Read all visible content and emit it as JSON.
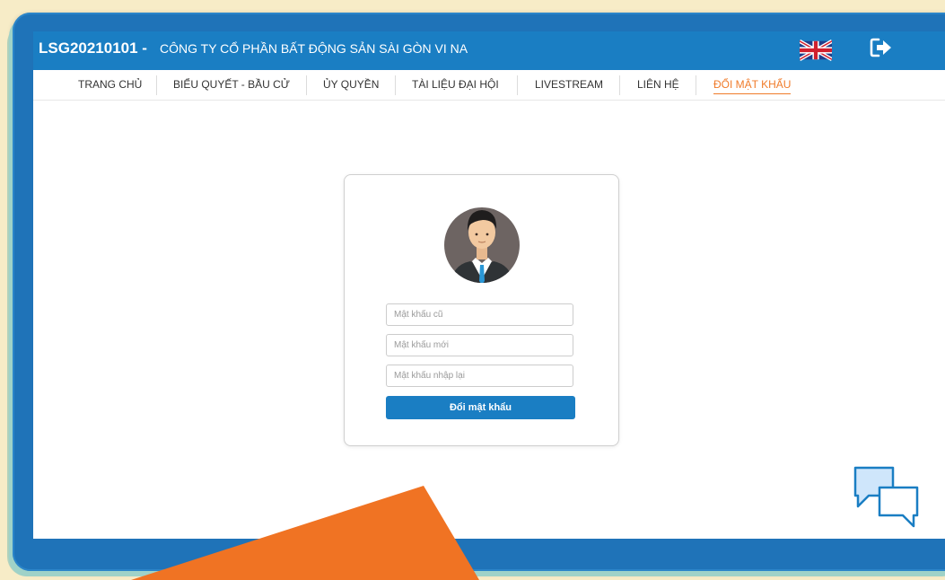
{
  "header": {
    "company_code": "LSG20210101 -",
    "company_name": "CÔNG TY CỔ PHẦN BẤT ĐỘNG SẢN SÀI GÒN VI NA"
  },
  "nav": {
    "items": [
      {
        "label": "TRANG CHỦ"
      },
      {
        "label": "BIỂU QUYẾT - BẦU CỬ"
      },
      {
        "label": "ỦY QUYỀN"
      },
      {
        "label": "TÀI LIỆU ĐẠI HỘI"
      },
      {
        "label": "LIVESTREAM"
      },
      {
        "label": "LIÊN HỆ"
      },
      {
        "label": "ĐỔI MẬT KHẨU",
        "active": true
      }
    ]
  },
  "form": {
    "old_password": {
      "placeholder": "Mật khẩu cũ",
      "value": ""
    },
    "new_password": {
      "placeholder": "Mật khẩu mới",
      "value": ""
    },
    "confirm_password": {
      "placeholder": "Mật khẩu nhập lại",
      "value": ""
    },
    "submit_label": "Đổi mật khẩu"
  },
  "icons": {
    "language": "uk-flag-icon",
    "logout": "logout-icon",
    "chat": "chat-bubbles-icon",
    "avatar": "user-avatar"
  },
  "colors": {
    "primary": "#1a7ec3",
    "active_nav": "#f07b2a",
    "background": "#f7ecc7",
    "accent_shape": "#f07323"
  }
}
